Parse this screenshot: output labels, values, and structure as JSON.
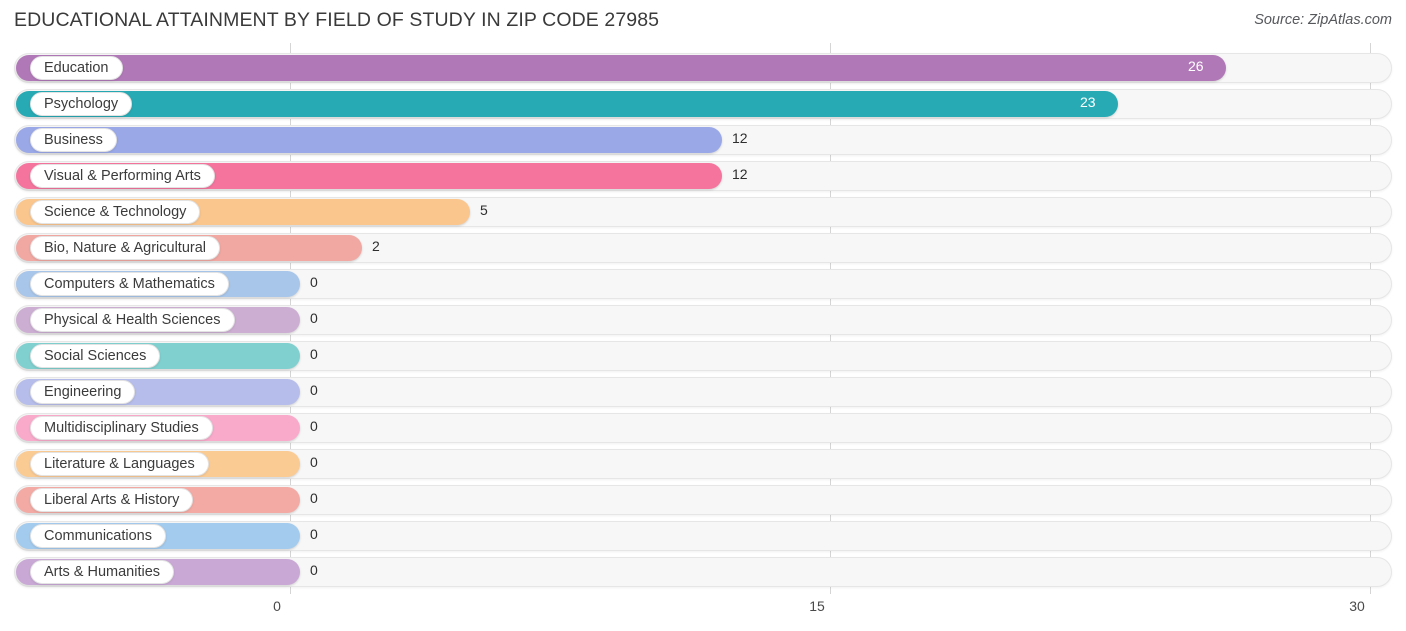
{
  "header": {
    "title": "EDUCATIONAL ATTAINMENT BY FIELD OF STUDY IN ZIP CODE 27985",
    "source": "Source: ZipAtlas.com"
  },
  "chart_data": {
    "type": "bar",
    "orientation": "horizontal",
    "title": "EDUCATIONAL ATTAINMENT BY FIELD OF STUDY IN ZIP CODE 27985",
    "xlabel": "",
    "ylabel": "",
    "xlim": [
      0,
      30
    ],
    "xticks": [
      0,
      15,
      30
    ],
    "xtick_labels": [
      "0",
      "15",
      "30"
    ],
    "grid": true,
    "legend": "none",
    "categories": [
      "Education",
      "Psychology",
      "Business",
      "Visual & Performing Arts",
      "Science & Technology",
      "Bio, Nature & Agricultural",
      "Computers & Mathematics",
      "Physical & Health Sciences",
      "Social Sciences",
      "Engineering",
      "Multidisciplinary Studies",
      "Literature & Languages",
      "Liberal Arts & History",
      "Communications",
      "Arts & Humanities"
    ],
    "values": [
      26,
      23,
      12,
      12,
      5,
      2,
      0,
      0,
      0,
      0,
      0,
      0,
      0,
      0,
      0
    ],
    "value_labels": [
      "26",
      "23",
      "12",
      "12",
      "5",
      "2",
      "0",
      "0",
      "0",
      "0",
      "0",
      "0",
      "0",
      "0",
      "0"
    ],
    "colors": [
      "#b178b8",
      "#27aab4",
      "#9aa8e8",
      "#f4749e",
      "#fac68e",
      "#f1a7a2",
      "#a8c6ea",
      "#cdaed3",
      "#7fd0cf",
      "#b6bdea",
      "#f9aacb",
      "#fbcb94",
      "#f3aaa4",
      "#a3cbee",
      "#c9a8d6"
    ]
  }
}
